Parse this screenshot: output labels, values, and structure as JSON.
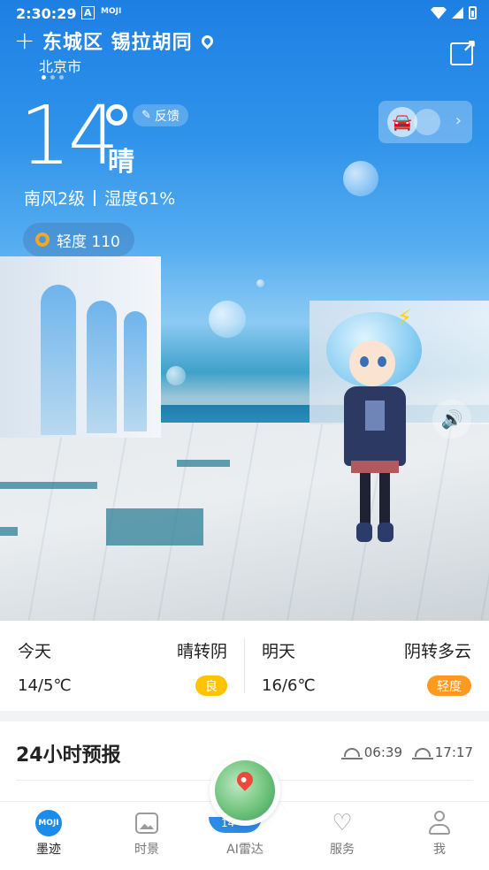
{
  "status_bar": {
    "time": "2:30:29",
    "app_icons": [
      "A",
      "MOJI"
    ]
  },
  "location": {
    "district": "东城区 锡拉胡同",
    "city": "北京市",
    "page_count": 3,
    "active_page": 0
  },
  "current": {
    "temperature": "14",
    "condition": "晴",
    "wind": "南风2级",
    "humidity": "湿度61%",
    "feedback_label": "反馈",
    "aqi_text": "轻度 110"
  },
  "forecast": {
    "today": {
      "label": "今天",
      "condition": "晴转阴",
      "temps": "14/5℃",
      "badge": "良",
      "badge_color": "#ffc300"
    },
    "tomorrow": {
      "label": "明天",
      "condition": "阴转多云",
      "temps": "16/6℃",
      "badge": "轻度",
      "badge_color": "#ff9a1f"
    }
  },
  "hourly": {
    "title": "24小时预报",
    "sunrise": "06:39",
    "sunset": "17:17"
  },
  "radar": {
    "temp_peek": "14"
  },
  "nav": {
    "items": [
      {
        "label": "墨迹",
        "icon": "moji-logo-icon",
        "active": true
      },
      {
        "label": "时景",
        "icon": "photo-icon",
        "active": false
      },
      {
        "label": "AI雷达",
        "icon": "radar-globe-icon",
        "active": false
      },
      {
        "label": "服务",
        "icon": "heart-hands-icon",
        "active": false
      },
      {
        "label": "我",
        "icon": "user-icon",
        "active": false
      }
    ],
    "moji_text": "MOJI"
  },
  "colors": {
    "accent": "#1d8bea",
    "good": "#ffc300",
    "light_pollution": "#ff9a1f",
    "aqi_ring": "#f5a623"
  }
}
